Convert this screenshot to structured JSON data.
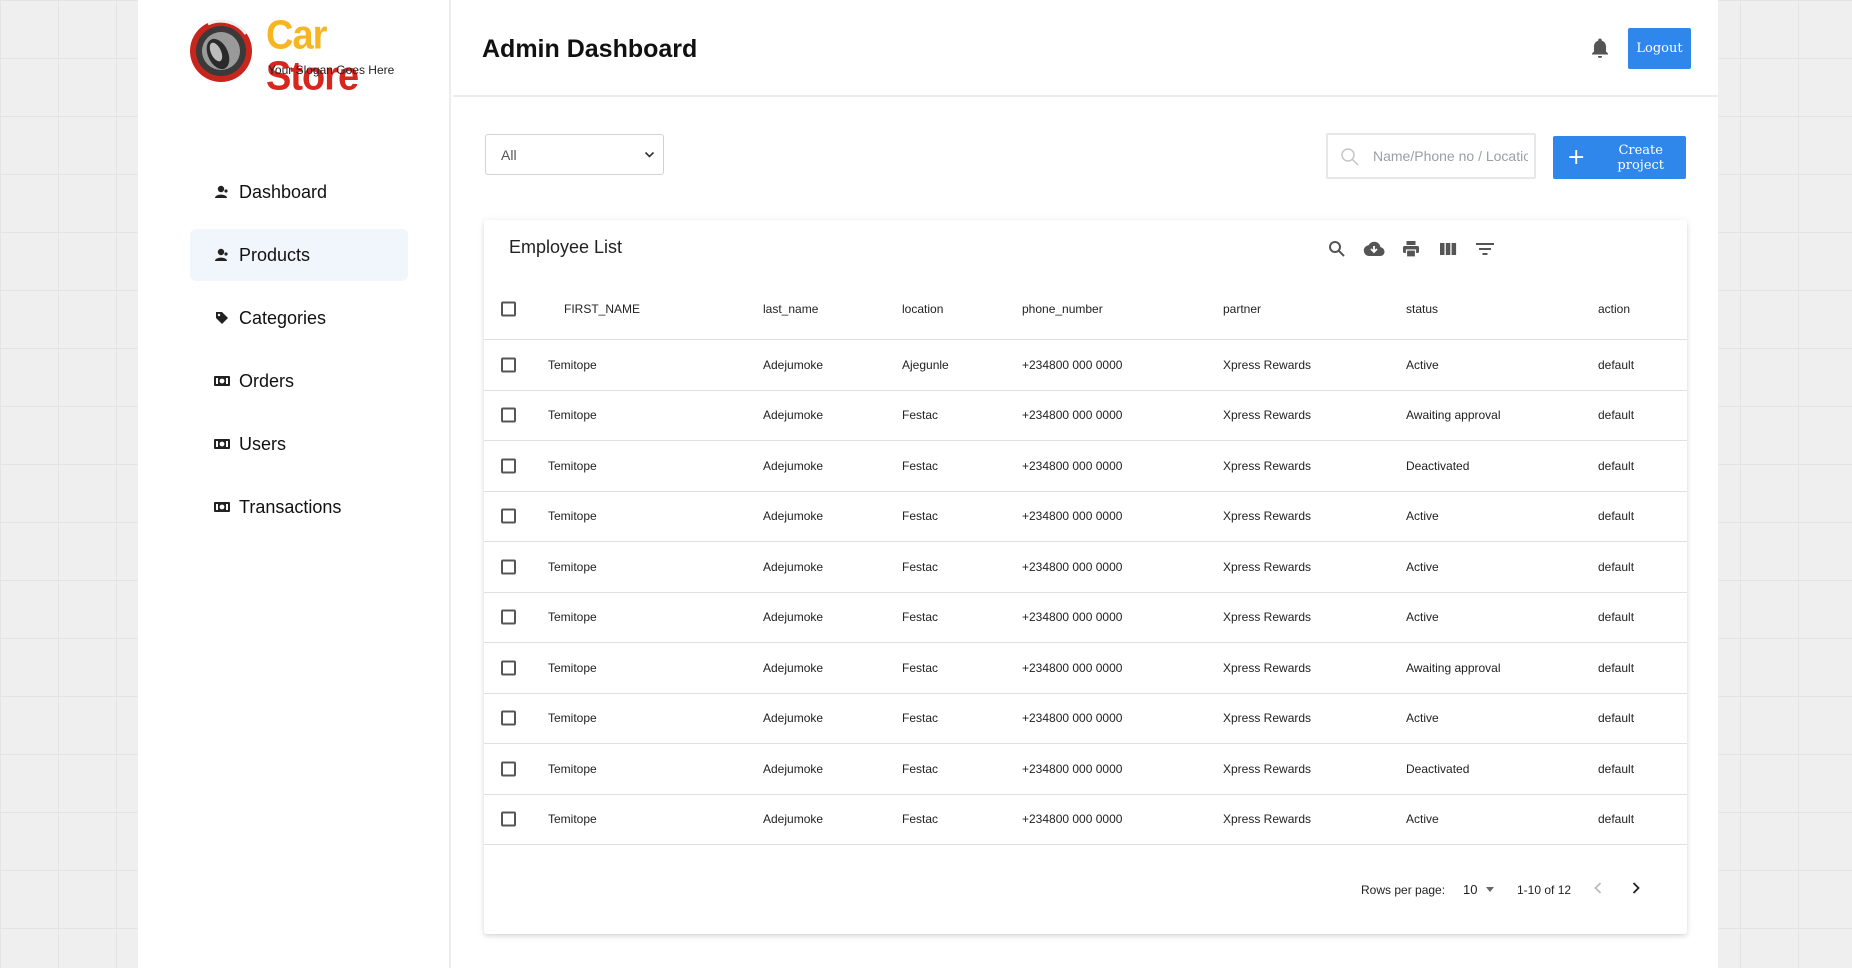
{
  "brand": {
    "name_part1": "Car ",
    "name_part2": "Store",
    "slogan": "Your Slogan Goes Here"
  },
  "sidebar": {
    "items": [
      {
        "label": "Dashboard",
        "icon": "user-icon",
        "active": false
      },
      {
        "label": "Products",
        "icon": "user-icon",
        "active": true
      },
      {
        "label": "Categories",
        "icon": "tags-icon",
        "active": false
      },
      {
        "label": "Orders",
        "icon": "money-icon",
        "active": false
      },
      {
        "label": "Users",
        "icon": "money-icon",
        "active": false
      },
      {
        "label": "Transactions",
        "icon": "money-icon",
        "active": false
      }
    ]
  },
  "header": {
    "title": "Admin Dashboard",
    "logout_label": "Logout",
    "notification_icon": "bell-icon"
  },
  "toolbar": {
    "filter_value": "All",
    "search_placeholder": "Name/Phone no / Location",
    "create_label": "Create project"
  },
  "table": {
    "title": "Employee List",
    "tools": [
      "search-icon",
      "cloud-download-icon",
      "print-icon",
      "view-columns-icon",
      "filter-list-icon"
    ],
    "columns": [
      "FIRST_NAME",
      "last_name",
      "location",
      "phone_number",
      "partner",
      "status",
      "action"
    ],
    "rows": [
      [
        "Temitope",
        "Adejumoke",
        "Ajegunle",
        "+234800 000 0000",
        "Xpress Rewards",
        "Active",
        "default"
      ],
      [
        "Temitope",
        "Adejumoke",
        "Festac",
        "+234800 000 0000",
        "Xpress Rewards",
        "Awaiting approval",
        "default"
      ],
      [
        "Temitope",
        "Adejumoke",
        "Festac",
        "+234800 000 0000",
        "Xpress Rewards",
        "Deactivated",
        "default"
      ],
      [
        "Temitope",
        "Adejumoke",
        "Festac",
        "+234800 000 0000",
        "Xpress Rewards",
        "Active",
        "default"
      ],
      [
        "Temitope",
        "Adejumoke",
        "Festac",
        "+234800 000 0000",
        "Xpress Rewards",
        "Active",
        "default"
      ],
      [
        "Temitope",
        "Adejumoke",
        "Festac",
        "+234800 000 0000",
        "Xpress Rewards",
        "Active",
        "default"
      ],
      [
        "Temitope",
        "Adejumoke",
        "Festac",
        "+234800 000 0000",
        "Xpress Rewards",
        "Awaiting approval",
        "default"
      ],
      [
        "Temitope",
        "Adejumoke",
        "Festac",
        "+234800 000 0000",
        "Xpress Rewards",
        "Active",
        "default"
      ],
      [
        "Temitope",
        "Adejumoke",
        "Festac",
        "+234800 000 0000",
        "Xpress Rewards",
        "Deactivated",
        "default"
      ],
      [
        "Temitope",
        "Adejumoke",
        "Festac",
        "+234800 000 0000",
        "Xpress Rewards",
        "Active",
        "default"
      ]
    ],
    "pagination": {
      "rows_per_page_label": "Rows per page:",
      "rows_per_page": "10",
      "range": "1-10 of 12"
    }
  },
  "colors": {
    "accent": "#2f87ec",
    "logo_yellow": "#f7b51f",
    "logo_red": "#d8261e",
    "active_nav": "#f1f6fc"
  }
}
